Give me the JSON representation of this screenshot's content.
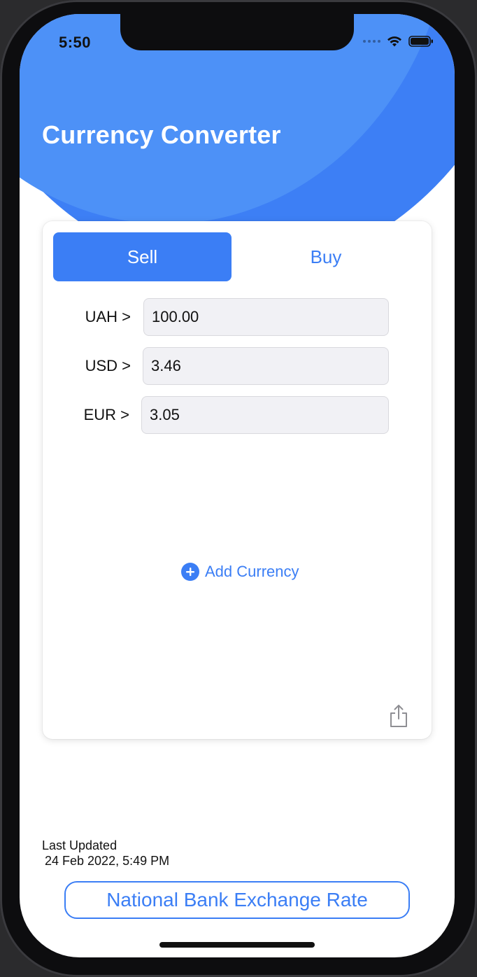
{
  "status_bar": {
    "time": "5:50"
  },
  "header": {
    "title": "Currency Converter",
    "accent_color": "#4d91f7"
  },
  "segmented_control": {
    "options": [
      "Sell",
      "Buy"
    ],
    "selected": "Sell"
  },
  "currencies": [
    {
      "label": "UAH >",
      "value": "100.00"
    },
    {
      "label": "USD >",
      "value": "3.46"
    },
    {
      "label": "EUR >",
      "value": "3.05"
    }
  ],
  "add_currency": {
    "label": "Add Currency",
    "icon": "plus-circle-icon"
  },
  "share": {
    "icon": "share-icon"
  },
  "footer": {
    "last_updated_label": "Last Updated",
    "last_updated_value": "24 Feb 2022, 5:49 PM",
    "nbu_button_label": "National Bank Exchange Rate"
  },
  "colors": {
    "primary": "#3b7ef5",
    "field_bg": "#f1f1f5"
  }
}
